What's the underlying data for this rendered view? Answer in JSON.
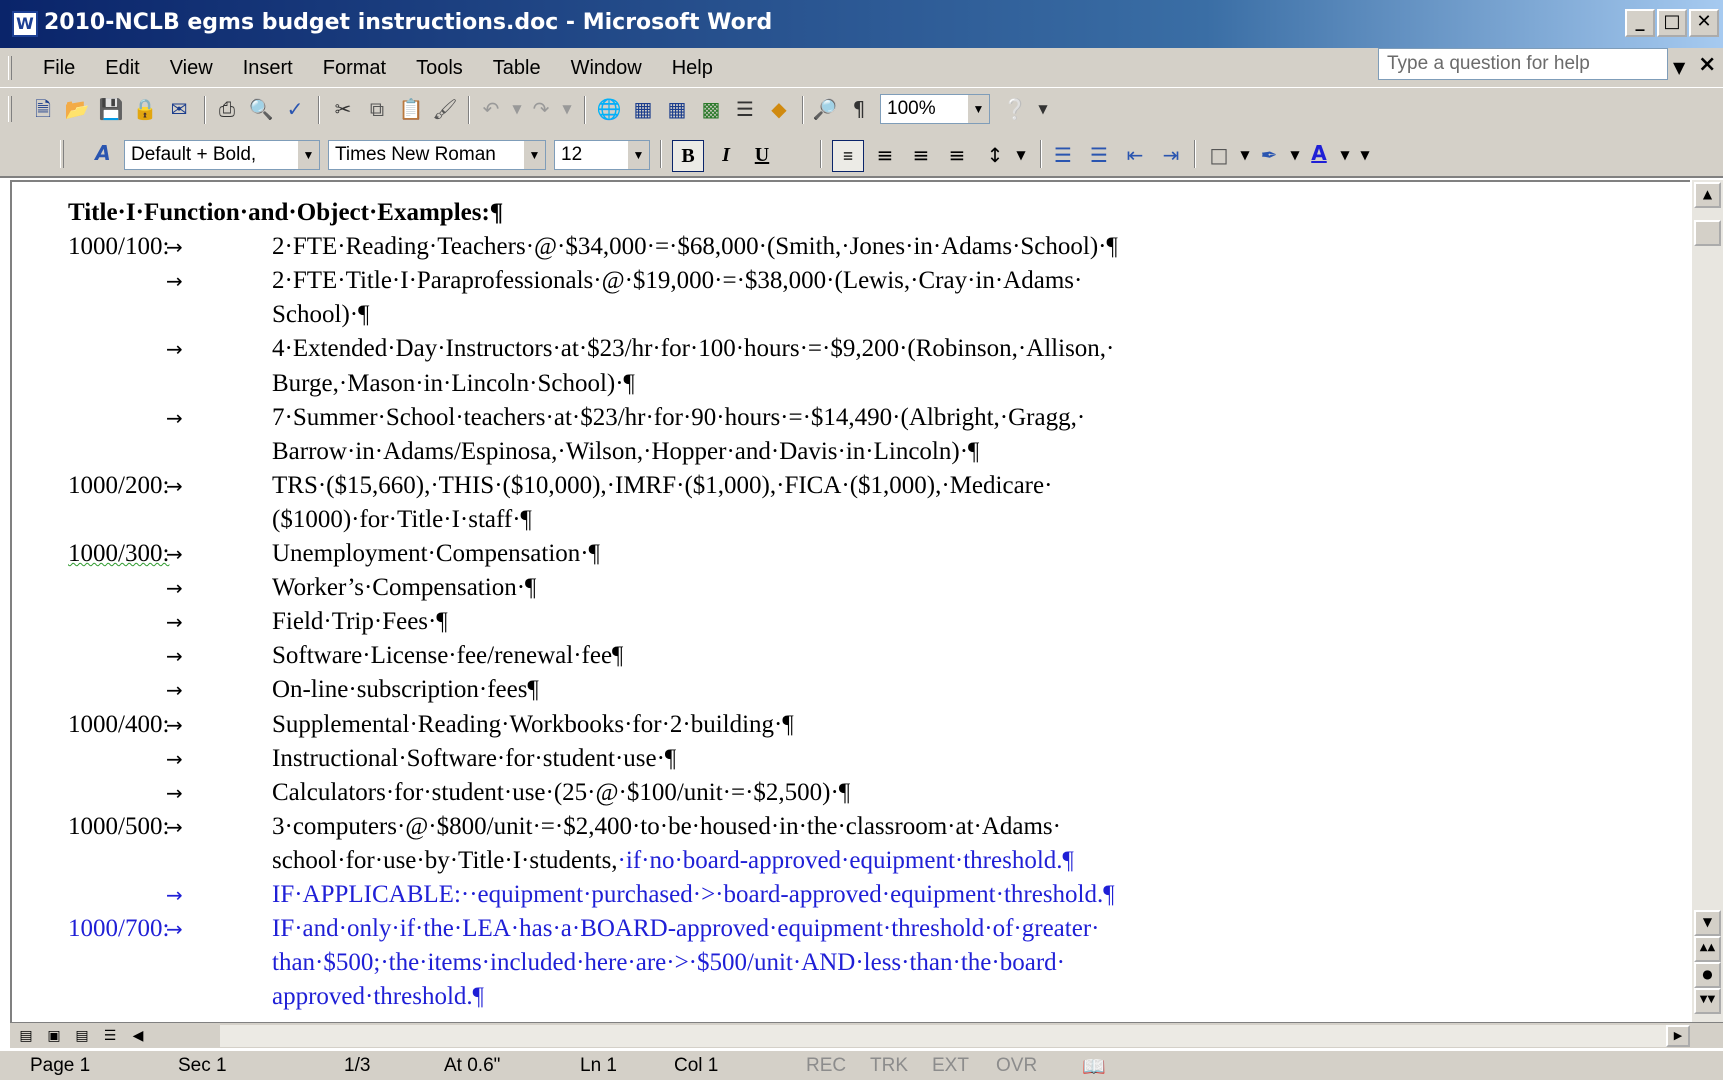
{
  "window": {
    "title": "2010-NCLB egms budget instructions.doc - Microsoft Word",
    "app_icon": "W",
    "controls": [
      "_",
      "□",
      "✕"
    ]
  },
  "menubar": {
    "items": [
      "File",
      "Edit",
      "View",
      "Insert",
      "Format",
      "Tools",
      "Table",
      "Window",
      "Help"
    ],
    "help_placeholder": "Type a question for help"
  },
  "toolbar": {
    "zoom": "100%",
    "style": "Default + Bold,",
    "font": "Times New Roman",
    "size": "12",
    "bold": "B",
    "italic": "I",
    "underline": "U"
  },
  "document": {
    "heading": "Title·I·Function·and·Object·Examples:¶",
    "lines": [
      {
        "code": "1000/100:",
        "arrow": "→",
        "text": "2·FTE·Reading·Teachers·@·$34,000·=·$68,000·(Smith,·Jones·in·Adams·School)·¶"
      },
      {
        "code": "",
        "arrow": "→",
        "text": "2·FTE·Title·I·Paraprofessionals·@·$19,000·=·$38,000·(Lewis,·Cray·in·Adams·"
      },
      {
        "code": "",
        "arrow": "",
        "text": "School)·¶"
      },
      {
        "code": "",
        "arrow": "→",
        "text": "4·Extended·Day·Instructors·at·$23/hr·for·100·hours·=·$9,200·(Robinson,·Allison,·"
      },
      {
        "code": "",
        "arrow": "",
        "text": "Burge,·Mason·in·Lincoln·School)·¶"
      },
      {
        "code": "",
        "arrow": "→",
        "text": "7·Summer·School·teachers·at·$23/hr·for·90·hours·=·$14,490·(Albright,·Gragg,·"
      },
      {
        "code": "",
        "arrow": "",
        "text": "Barrow·in·Adams/Espinosa,·Wilson,·Hopper·and·Davis·in·Lincoln)·¶"
      },
      {
        "code": "1000/200:",
        "arrow": "→",
        "text": "TRS·($15,660),·THIS·($10,000),·IMRF·($1,000),·FICA·($1,000),·Medicare·"
      },
      {
        "code": "",
        "arrow": "",
        "text": "($1000)·for·Title·I·staff·¶"
      },
      {
        "code": "1000/300:",
        "arrow": "→",
        "text": "Unemployment·Compensation·¶",
        "squig": true
      },
      {
        "code": "",
        "arrow": "→",
        "text": "Worker’s·Compensation·¶"
      },
      {
        "code": "",
        "arrow": "→",
        "text": "Field·Trip·Fees·¶"
      },
      {
        "code": "",
        "arrow": "→",
        "text": "Software·License·fee/renewal·fee¶"
      },
      {
        "code": "",
        "arrow": "→",
        "text": "On-line·subscription·fees¶"
      },
      {
        "code": "1000/400:",
        "arrow": "→",
        "text": "Supplemental·Reading·Workbooks·for·2·building·¶"
      },
      {
        "code": "",
        "arrow": "→",
        "text": "Instructional·Software·for·student·use·¶"
      },
      {
        "code": "",
        "arrow": "→",
        "text": "Calculators·for·student·use·(25·@·$100/unit·=·$2,500)·¶"
      },
      {
        "code": "1000/500:",
        "arrow": "→",
        "text": "3·computers·@·$800/unit·=·$2,400·to·be·housed·in·the·classroom·at·Adams·"
      },
      {
        "code": "",
        "arrow": "",
        "text": "school·for·use·by·Title·I·students,",
        "blue_tail": "·if·no·board-approved·equipment·threshold.¶"
      },
      {
        "code": "",
        "arrow": "→",
        "text": "IF·APPLICABLE:··equipment·purchased·>·board-approved·equipment·threshold.¶",
        "blue": true
      },
      {
        "code": "1000/700:",
        "arrow": "→",
        "text": "IF·and·only·if·the·LEA·has·a·BOARD-approved·equipment·threshold·of·greater·",
        "blue": true,
        "blue_code": true
      },
      {
        "code": "",
        "arrow": "",
        "text": "than·$500;·the·items·included·here·are·>·$500/unit·AND·less·than·the·board·",
        "blue": true
      },
      {
        "code": "",
        "arrow": "",
        "text": "approved·threshold.¶",
        "blue": true
      }
    ]
  },
  "statusbar": {
    "page": "Page 1",
    "sec": "Sec 1",
    "pages": "1/3",
    "at": "At 0.6\"",
    "ln": "Ln 1",
    "col": "Col 1",
    "rec": "REC",
    "trk": "TRK",
    "ext": "EXT",
    "ovr": "OVR"
  }
}
